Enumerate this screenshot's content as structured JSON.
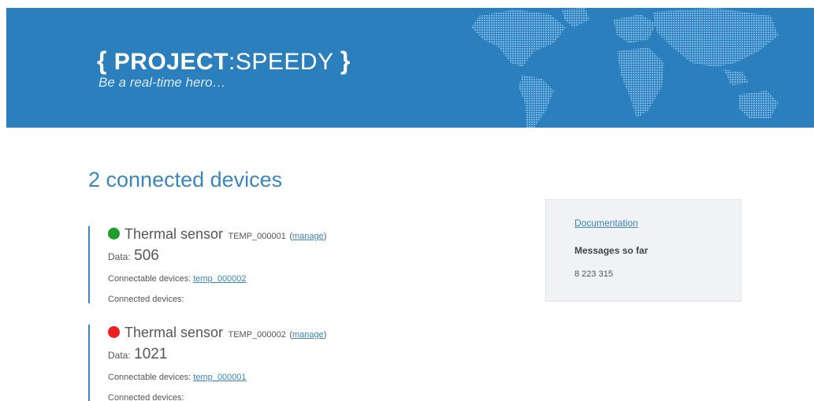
{
  "header": {
    "brace_open": "{",
    "brand_bold": "PROJECT",
    "brand_light": ":SPEEDY",
    "brace_close": "}",
    "tagline": "Be a real-time hero…"
  },
  "main": {
    "heading": "2 connected devices",
    "devices": [
      {
        "status_color": "#1f9e2a",
        "name": "Thermal sensor",
        "id": "TEMP_000001",
        "manage_label": "manage",
        "data_label": "Data:",
        "data_value": "506",
        "connectable_label": "Connectable devices:",
        "connectable_link": "temp_000002",
        "connected_label": "Connected devices:"
      },
      {
        "status_color": "#ef1f1f",
        "name": "Thermal sensor",
        "id": "TEMP_000002",
        "manage_label": "manage",
        "data_label": "Data:",
        "data_value": "1021",
        "connectable_label": "Connectable devices:",
        "connectable_link": "temp_000001",
        "connected_label": "Connected devices:"
      }
    ]
  },
  "sidebar": {
    "documentation_link": "Documentation",
    "messages_label": "Messages so far",
    "messages_value": "8 223 315"
  },
  "colors": {
    "banner": "#2c7fbd",
    "accent": "#3a86c0",
    "status_online": "#1f9e2a",
    "status_offline": "#ef1f1f"
  },
  "icons": [
    "world-map-graphic",
    "status-dot-icon"
  ]
}
